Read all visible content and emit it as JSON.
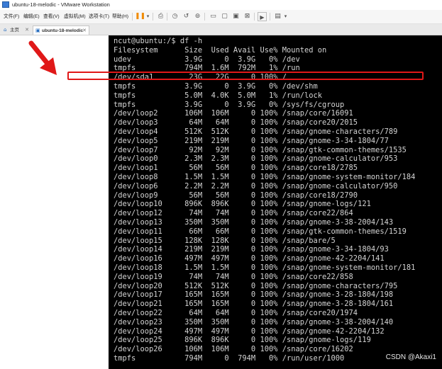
{
  "window": {
    "title": "ubuntu-18-melodic - VMware Workstation",
    "app_icon": "vmware-icon"
  },
  "menubar": {
    "items": [
      "文件(F)",
      "编辑(E)",
      "查看(V)",
      "虚拟机(M)",
      "选项卡(T)",
      "帮助(H)"
    ],
    "tool_icons": [
      "pause-icon",
      "dropdown-icon",
      "send-keys-icon",
      "snapshot-icon",
      "revert-snapshot-icon",
      "manage-snapshots-icon",
      "fullscreen-icon",
      "unity-icon",
      "thumbnail-icon",
      "console-icon",
      "view-icon"
    ]
  },
  "tabs": [
    {
      "label": "主页",
      "icon": "home-icon"
    },
    {
      "label": "ubuntu-18-melodic",
      "icon": "vm-icon",
      "active": true
    }
  ],
  "terminal": {
    "lines": [
      "ncut@ubuntu:/$ df -h",
      "Filesystem      Size  Used Avail Use% Mounted on",
      "udev            3.9G     0  3.9G   0% /dev",
      "tmpfs           794M  1.6M  792M   1% /run",
      "/dev/sda1        23G   22G     0 100% /",
      "tmpfs           3.9G     0  3.9G   0% /dev/shm",
      "tmpfs           5.0M  4.0K  5.0M   1% /run/lock",
      "tmpfs           3.9G     0  3.9G   0% /sys/fs/cgroup",
      "/dev/loop2      106M  106M     0 100% /snap/core/16091",
      "/dev/loop3       64M   64M     0 100% /snap/core20/2015",
      "/dev/loop4      512K  512K     0 100% /snap/gnome-characters/789",
      "/dev/loop5      219M  219M     0 100% /snap/gnome-3-34-1804/77",
      "/dev/loop7       92M   92M     0 100% /snap/gtk-common-themes/1535",
      "/dev/loop0      2.3M  2.3M     0 100% /snap/gnome-calculator/953",
      "/dev/loop1       56M   56M     0 100% /snap/core18/2785",
      "/dev/loop8      1.5M  1.5M     0 100% /snap/gnome-system-monitor/184",
      "/dev/loop6      2.2M  2.2M     0 100% /snap/gnome-calculator/950",
      "/dev/loop9       56M   56M     0 100% /snap/core18/2790",
      "/dev/loop10     896K  896K     0 100% /snap/gnome-logs/121",
      "/dev/loop12      74M   74M     0 100% /snap/core22/864",
      "/dev/loop13     350M  350M     0 100% /snap/gnome-3-38-2004/143",
      "/dev/loop11      66M   66M     0 100% /snap/gtk-common-themes/1519",
      "/dev/loop15     128K  128K     0 100% /snap/bare/5",
      "/dev/loop14     219M  219M     0 100% /snap/gnome-3-34-1804/93",
      "/dev/loop16     497M  497M     0 100% /snap/gnome-42-2204/141",
      "/dev/loop18     1.5M  1.5M     0 100% /snap/gnome-system-monitor/181",
      "/dev/loop19      74M   74M     0 100% /snap/core22/858",
      "/dev/loop20     512K  512K     0 100% /snap/gnome-characters/795",
      "/dev/loop17     165M  165M     0 100% /snap/gnome-3-28-1804/198",
      "/dev/loop21     165M  165M     0 100% /snap/gnome-3-28-1804/161",
      "/dev/loop22      64M   64M     0 100% /snap/core20/1974",
      "/dev/loop23     350M  350M     0 100% /snap/gnome-3-38-2004/140",
      "/dev/loop24     497M  497M     0 100% /snap/gnome-42-2204/132",
      "/dev/loop25     896K  896K     0 100% /snap/gnome-logs/119",
      "/dev/loop26     106M  106M     0 100% /snap/core/16202",
      "tmpfs           794M     0  794M   0% /run/user/1000"
    ]
  },
  "annotation": {
    "arrow_color": "#e01818",
    "box_color": "#e01818",
    "highlighted_line": "/dev/sda1        23G   22G     0 100% /"
  },
  "watermark": "CSDN @Akaxi1"
}
